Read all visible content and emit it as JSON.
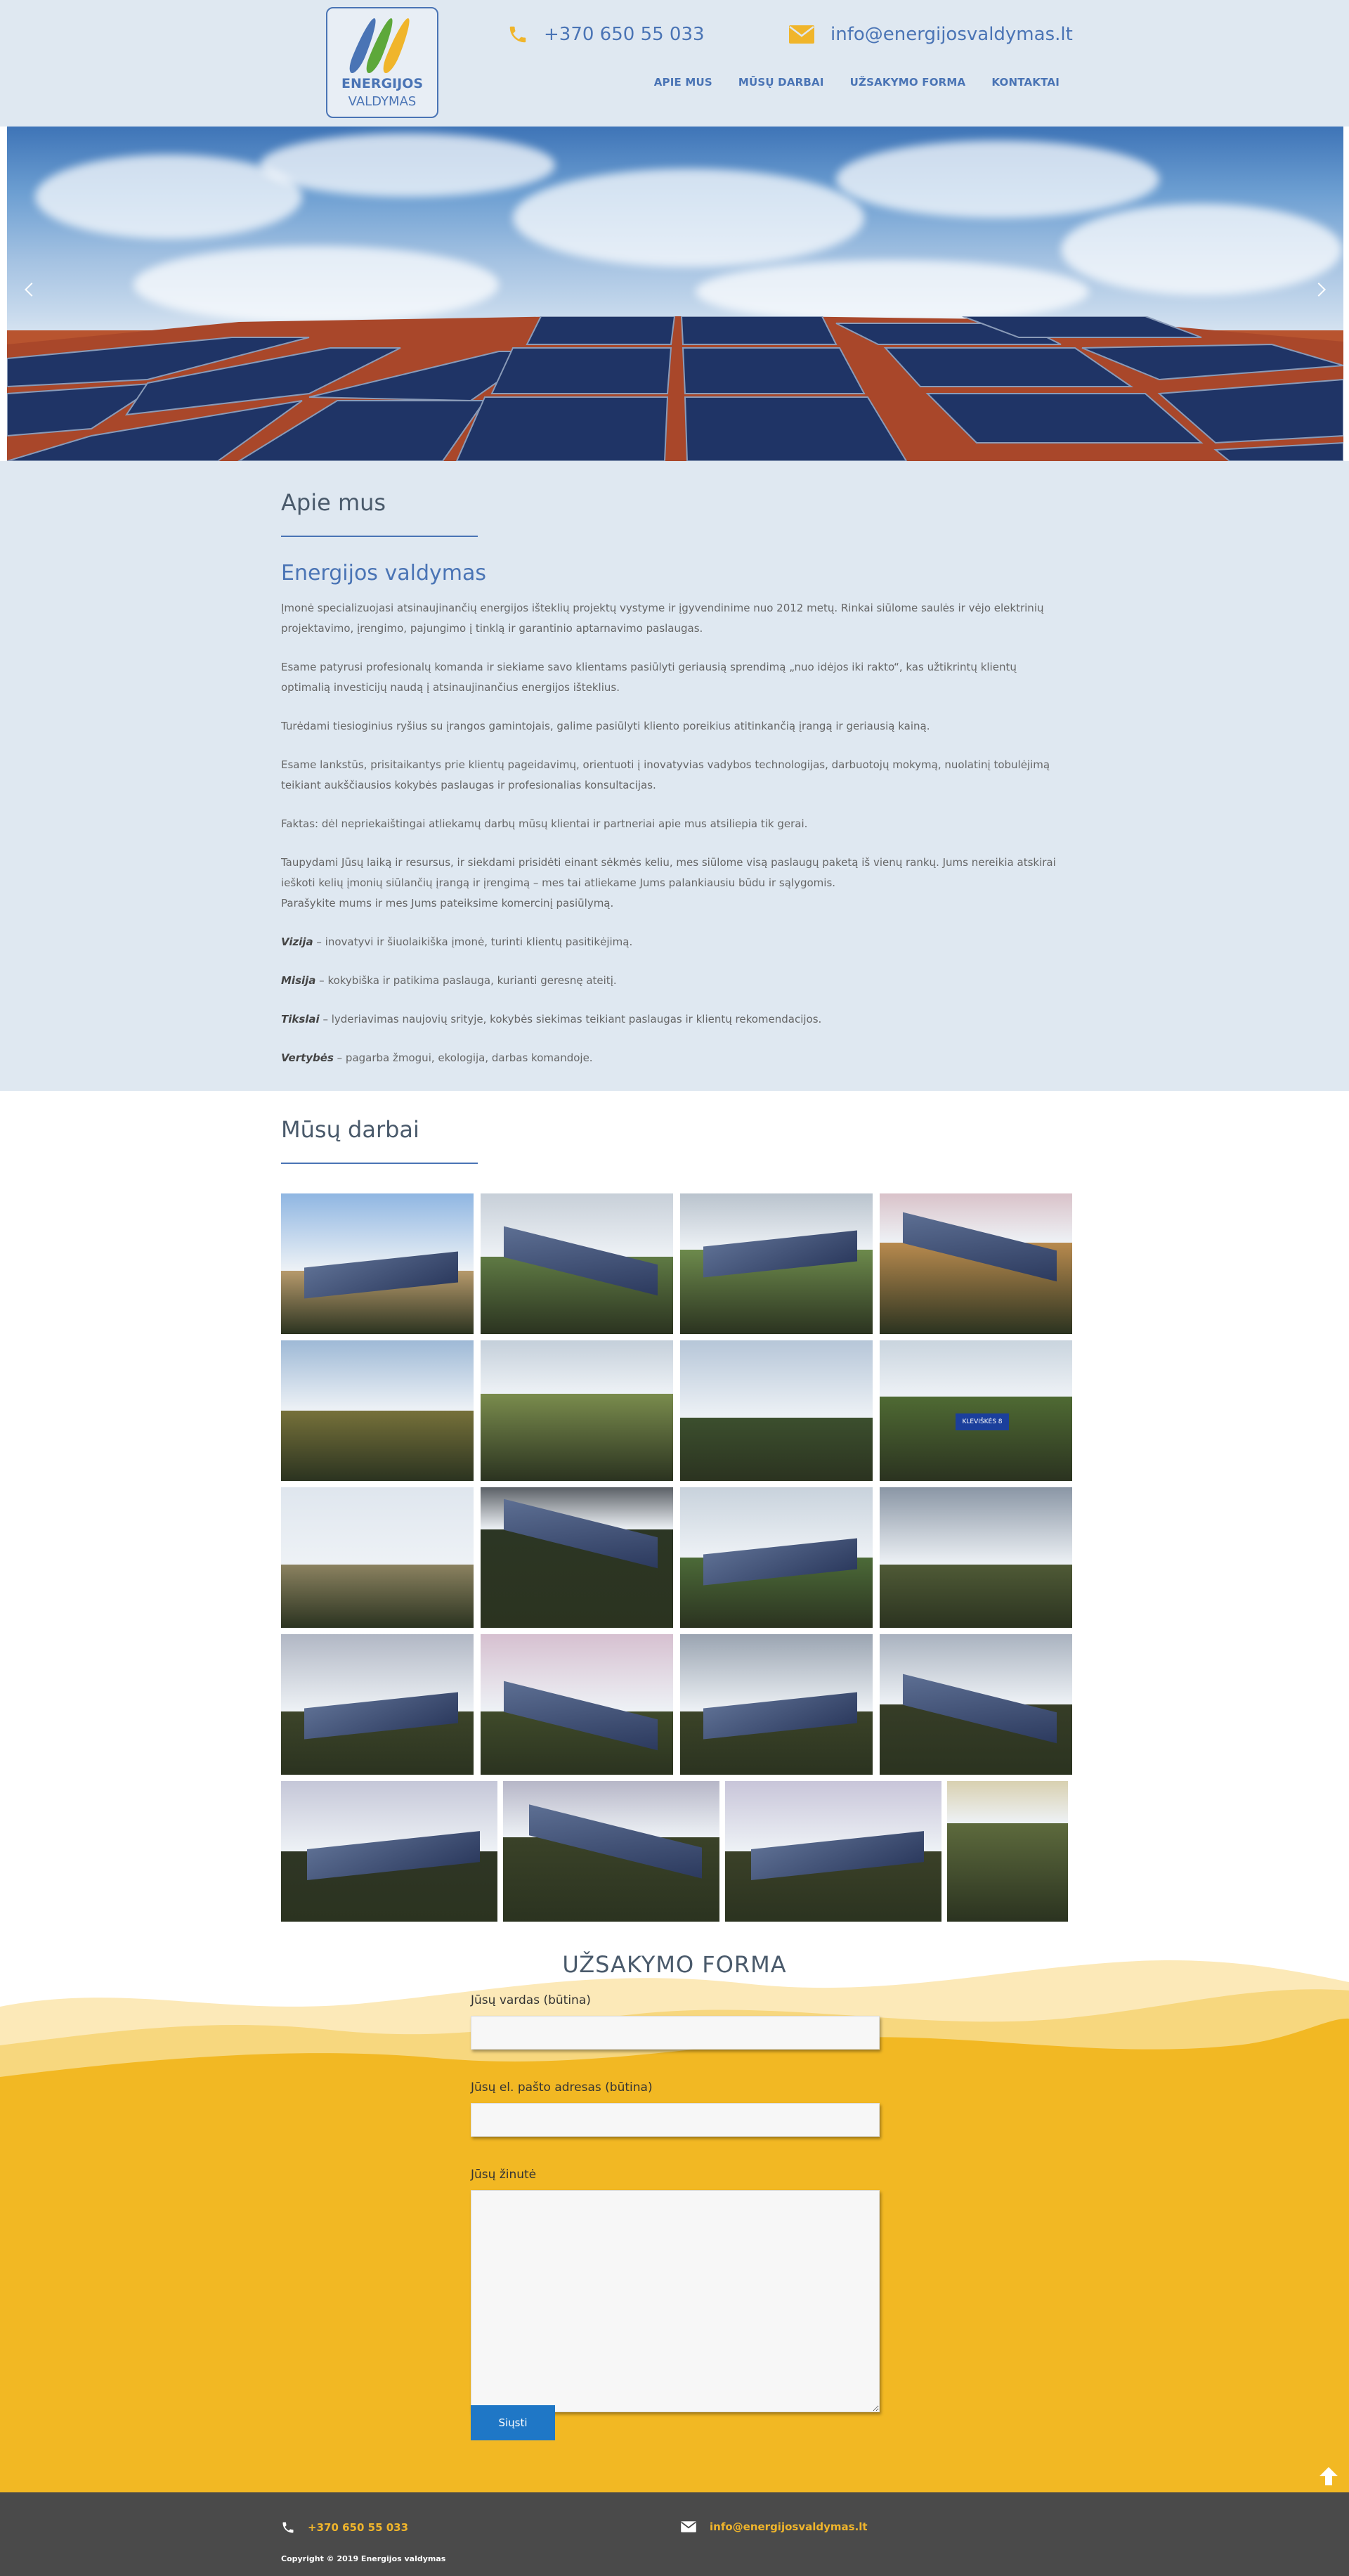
{
  "header": {
    "logo_line1": "ENERGIJOS",
    "logo_line2": "VALDYMAS",
    "phone": "+370 650 55 033",
    "email": "info@energijosvaldymas.lt",
    "nav": [
      "APIE MUS",
      "MŪSŲ DARBAI",
      "UŽSAKYMO FORMA",
      "KONTAKTAI"
    ]
  },
  "about": {
    "title": "Apie mus",
    "subtitle": "Energijos valdymas",
    "paragraphs": [
      "Įmonė specializuojasi atsinaujinančių energijos išteklių projektų vystyme ir įgyvendinime nuo 2012 metų. Rinkai siūlome saulės ir vėjo elektrinių projektavimo, įrengimo, pajungimo į tinklą ir garantinio aptarnavimo paslaugas.",
      "Esame patyrusi profesionalų komanda ir siekiame savo klientams pasiūlyti geriausią sprendimą „nuo idėjos iki rakto“, kas užtikrintų klientų optimalią investicijų naudą į atsinaujinančius energijos išteklius.",
      "Turėdami tiesioginius ryšius su įrangos gamintojais, galime pasiūlyti kliento poreikius atitinkančią įrangą ir geriausią kainą.",
      "Esame lankstūs, prisitaikantys prie klientų pageidavimų, orientuoti į inovatyvias vadybos technologijas, darbuotojų mokymą, nuolatinį tobulėjimą teikiant aukščiausios kokybės paslaugas ir profesionalias konsultacijas.",
      "Faktas: dėl nepriekaištingai atliekamų darbų mūsų klientai ir partneriai apie mus atsiliepia tik gerai.",
      "Taupydami Jūsų laiką ir resursus, ir siekdami prisidėti einant sėkmės keliu, mes siūlome visą paslaugų paketą iš vienų rankų. Jums nereikia atskirai ieškoti kelių įmonių siūlančių įrangą ir įrengimą – mes tai atliekame Jums palankiausiu būdu ir sąlygomis."
    ],
    "cta": "Parašykite mums ir mes Jums pateiksime komercinį pasiūlymą.",
    "values": [
      {
        "term": "Vizija",
        "text": " – inovatyvi ir šiuolaikiška įmonė, turinti klientų pasitikėjimą."
      },
      {
        "term": "Misija",
        "text": " – kokybiška ir patikima paslauga, kurianti geresnę ateitį."
      },
      {
        "term": "Tikslai",
        "text": " – lyderiavimas naujovių srityje, kokybės siekimas teikiant paslaugas ir klientų rekomendacijos."
      },
      {
        "term": "Vertybės",
        "text": " – pagarba žmogui, ekologija, darbas komandoje."
      }
    ]
  },
  "works": {
    "title": "Mūsų darbai",
    "sign_text": "KLEVIŠKĖS 8"
  },
  "form": {
    "title": "UŽSAKYMO FORMA",
    "name_label": "Jūsų vardas (būtina)",
    "email_label": "Jūsų el. pašto adresas (būtina)",
    "message_label": "Jūsų žinutė",
    "submit": "Siųsti"
  },
  "footer": {
    "phone": "+370 650 55 033",
    "email": "info@energijosvaldymas.lt",
    "copyright": "Copyright © 2019 Energijos valdymas"
  },
  "colors": {
    "brand_blue": "#4a74b5",
    "accent_yellow": "#f0b52b",
    "light_bg": "#dfe8f1",
    "footer_bg": "#4a4a4a",
    "button_blue": "#1f77c6"
  },
  "icons": [
    "phone-icon",
    "envelope-icon",
    "chevron-left-icon",
    "chevron-right-icon",
    "arrow-up-icon"
  ]
}
